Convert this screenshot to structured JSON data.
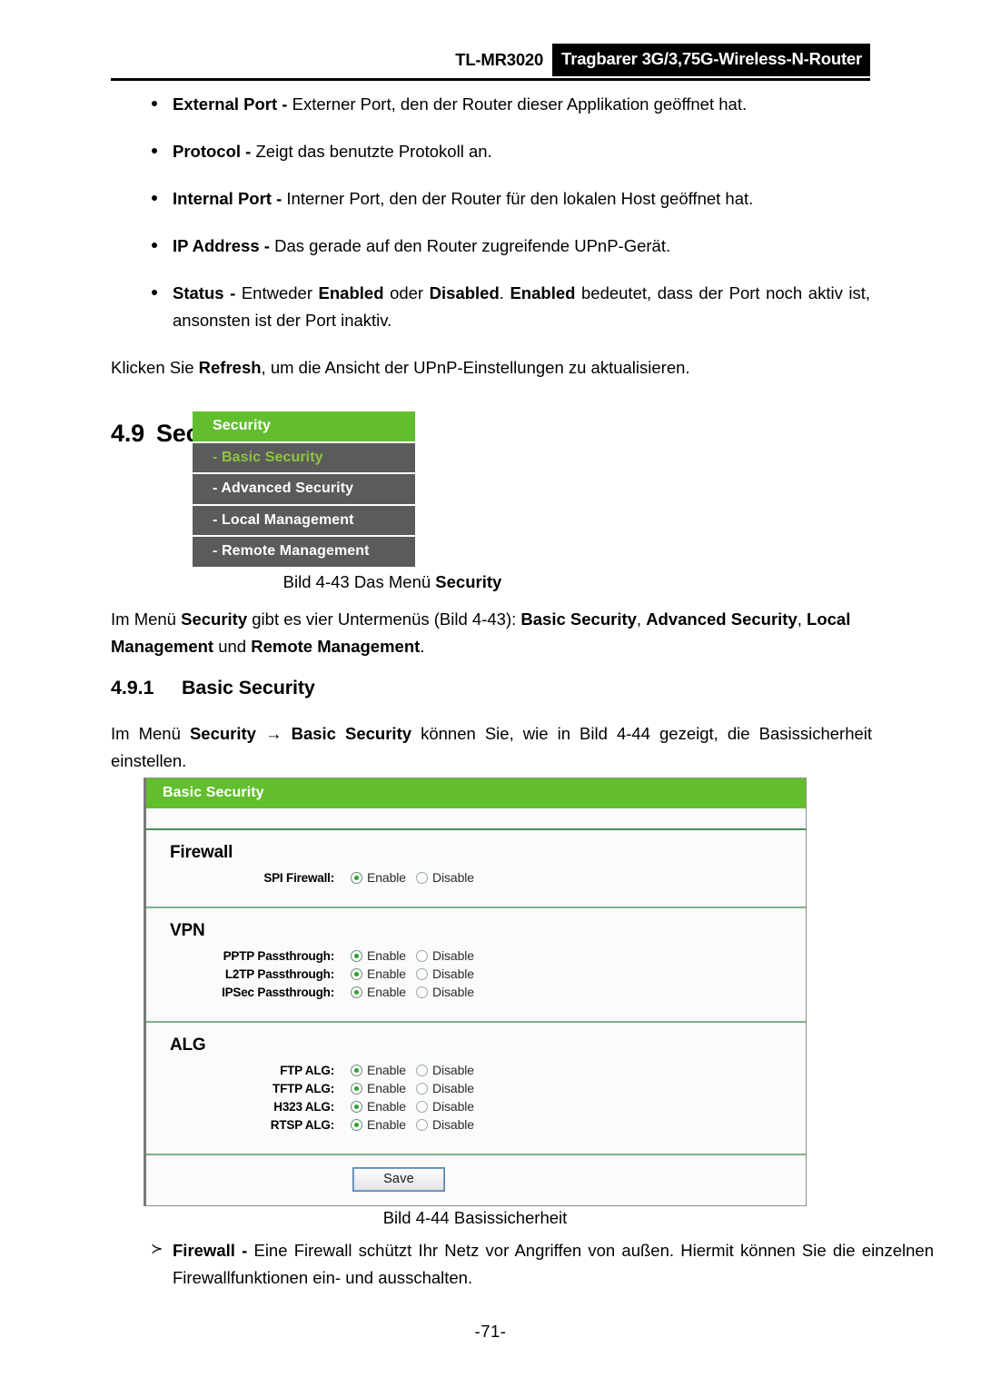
{
  "header": {
    "model": "TL-MR3020",
    "product": "Tragbarer 3G/3,75G-Wireless-N-Router"
  },
  "bullets": [
    {
      "term": "External Port",
      "dash": " - ",
      "text": "Externer Port, den der Router dieser Applikation geöffnet hat."
    },
    {
      "term": "Protocol",
      "dash": " - ",
      "text": "Zeigt das benutzte Protokoll an."
    },
    {
      "term": "Internal Port",
      "dash": " - ",
      "text": "Interner Port, den der Router für den lokalen Host geöffnet hat."
    },
    {
      "term": "IP Address",
      "dash": " - ",
      "text": "Das gerade auf den Router zugreifende UPnP-Gerät."
    }
  ],
  "status_bullet": {
    "term": "Status",
    "dash": " - ",
    "part1": "Entweder ",
    "bold1": "Enabled",
    "part2": " oder ",
    "bold2": "Disabled",
    "part3": ". ",
    "bold3": "Enabled",
    "part4": " bedeutet, dass der Port noch aktiv ist, ansonsten ist der Port inaktiv."
  },
  "refresh_para": {
    "pre": "Klicken Sie ",
    "bold": "Refresh",
    "post": ", um die Ansicht der UPnP-Einstellungen zu aktualisieren."
  },
  "section": {
    "number": "4.9",
    "title": "Security"
  },
  "security_menu": {
    "header": "Security",
    "items": [
      {
        "label": "- Basic Security",
        "active": true
      },
      {
        "label": "- Advanced Security",
        "active": false
      },
      {
        "label": "- Local Management",
        "active": false
      },
      {
        "label": "- Remote Management",
        "active": false
      }
    ]
  },
  "figure_43": {
    "pre": "Bild 4-43 Das Menü ",
    "bold": "Security"
  },
  "menu_para": {
    "pre": "Im Menü ",
    "bold1": "Security",
    "mid1": " gibt es vier Untermenüs (Bild 4-43): ",
    "bold2": "Basic Security",
    "mid2": ", ",
    "bold3": "Advanced Security",
    "mid3": ", ",
    "bold4": "Local Management",
    "mid4": " und ",
    "bold5": "Remote Management",
    "post": "."
  },
  "subsection": {
    "number": "4.9.1",
    "title": "Basic Security"
  },
  "basic_para": {
    "pre": "Im Menü ",
    "bold1": "Security",
    "arrow": " → ",
    "bold2": "Basic Security",
    "post": " können Sie, wie in Bild 4-44 gezeigt, die Basissicherheit einstellen."
  },
  "panel": {
    "title": "Basic Security",
    "sections": [
      {
        "heading": "Firewall",
        "rows": [
          {
            "label": "SPI Firewall:",
            "options": [
              {
                "label": "Enable",
                "checked": true
              },
              {
                "label": "Disable",
                "checked": false
              }
            ]
          }
        ]
      },
      {
        "heading": "VPN",
        "rows": [
          {
            "label": "PPTP Passthrough:",
            "options": [
              {
                "label": "Enable",
                "checked": true
              },
              {
                "label": "Disable",
                "checked": false
              }
            ]
          },
          {
            "label": "L2TP Passthrough:",
            "options": [
              {
                "label": "Enable",
                "checked": true
              },
              {
                "label": "Disable",
                "checked": false
              }
            ]
          },
          {
            "label": "IPSec Passthrough:",
            "options": [
              {
                "label": "Enable",
                "checked": true
              },
              {
                "label": "Disable",
                "checked": false
              }
            ]
          }
        ]
      },
      {
        "heading": "ALG",
        "rows": [
          {
            "label": "FTP ALG:",
            "options": [
              {
                "label": "Enable",
                "checked": true
              },
              {
                "label": "Disable",
                "checked": false
              }
            ]
          },
          {
            "label": "TFTP ALG:",
            "options": [
              {
                "label": "Enable",
                "checked": true
              },
              {
                "label": "Disable",
                "checked": false
              }
            ]
          },
          {
            "label": "H323 ALG:",
            "options": [
              {
                "label": "Enable",
                "checked": true
              },
              {
                "label": "Disable",
                "checked": false
              }
            ]
          },
          {
            "label": "RTSP ALG:",
            "options": [
              {
                "label": "Enable",
                "checked": true
              },
              {
                "label": "Disable",
                "checked": false
              }
            ]
          }
        ]
      }
    ],
    "save_label": "Save"
  },
  "figure_44": "Bild 4-44 Basissicherheit",
  "firewall_item": {
    "arrow": "≻",
    "term": "Firewall",
    "dash": " - ",
    "text": "Eine Firewall schützt Ihr Netz vor Angriffen von außen. Hiermit können Sie die einzelnen Firewallfunktionen ein- und ausschalten."
  },
  "page_number": "-71-",
  "colors": {
    "green_header": "#62BE2F",
    "menu_gray": "#5B5B5B",
    "menu_active_text": "#8CC63F",
    "radio_dot": "#2AA32A"
  }
}
